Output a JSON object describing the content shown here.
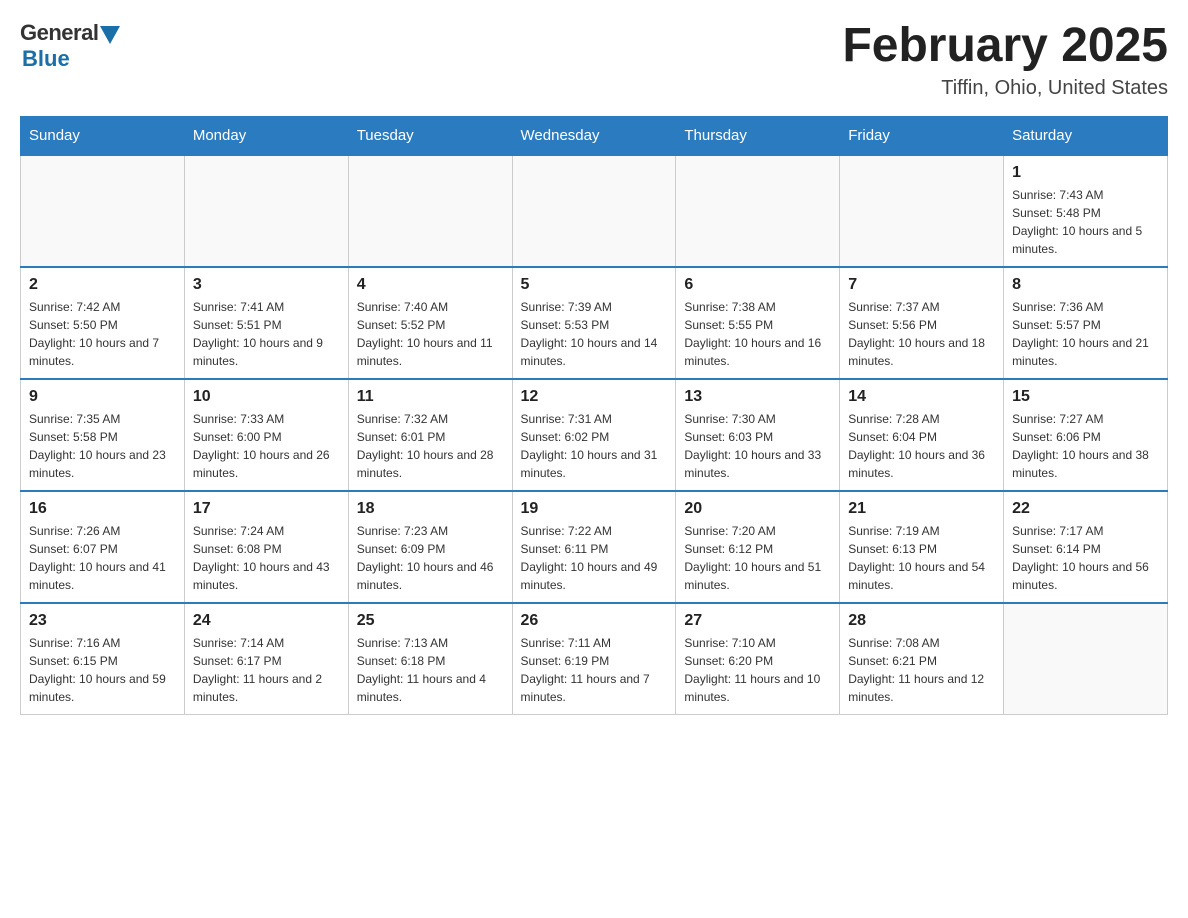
{
  "header": {
    "logo_general": "General",
    "logo_blue": "Blue",
    "month_title": "February 2025",
    "location": "Tiffin, Ohio, United States"
  },
  "days_of_week": [
    "Sunday",
    "Monday",
    "Tuesday",
    "Wednesday",
    "Thursday",
    "Friday",
    "Saturday"
  ],
  "weeks": [
    {
      "days": [
        {
          "num": "",
          "info": ""
        },
        {
          "num": "",
          "info": ""
        },
        {
          "num": "",
          "info": ""
        },
        {
          "num": "",
          "info": ""
        },
        {
          "num": "",
          "info": ""
        },
        {
          "num": "",
          "info": ""
        },
        {
          "num": "1",
          "info": "Sunrise: 7:43 AM\nSunset: 5:48 PM\nDaylight: 10 hours and 5 minutes."
        }
      ]
    },
    {
      "days": [
        {
          "num": "2",
          "info": "Sunrise: 7:42 AM\nSunset: 5:50 PM\nDaylight: 10 hours and 7 minutes."
        },
        {
          "num": "3",
          "info": "Sunrise: 7:41 AM\nSunset: 5:51 PM\nDaylight: 10 hours and 9 minutes."
        },
        {
          "num": "4",
          "info": "Sunrise: 7:40 AM\nSunset: 5:52 PM\nDaylight: 10 hours and 11 minutes."
        },
        {
          "num": "5",
          "info": "Sunrise: 7:39 AM\nSunset: 5:53 PM\nDaylight: 10 hours and 14 minutes."
        },
        {
          "num": "6",
          "info": "Sunrise: 7:38 AM\nSunset: 5:55 PM\nDaylight: 10 hours and 16 minutes."
        },
        {
          "num": "7",
          "info": "Sunrise: 7:37 AM\nSunset: 5:56 PM\nDaylight: 10 hours and 18 minutes."
        },
        {
          "num": "8",
          "info": "Sunrise: 7:36 AM\nSunset: 5:57 PM\nDaylight: 10 hours and 21 minutes."
        }
      ]
    },
    {
      "days": [
        {
          "num": "9",
          "info": "Sunrise: 7:35 AM\nSunset: 5:58 PM\nDaylight: 10 hours and 23 minutes."
        },
        {
          "num": "10",
          "info": "Sunrise: 7:33 AM\nSunset: 6:00 PM\nDaylight: 10 hours and 26 minutes."
        },
        {
          "num": "11",
          "info": "Sunrise: 7:32 AM\nSunset: 6:01 PM\nDaylight: 10 hours and 28 minutes."
        },
        {
          "num": "12",
          "info": "Sunrise: 7:31 AM\nSunset: 6:02 PM\nDaylight: 10 hours and 31 minutes."
        },
        {
          "num": "13",
          "info": "Sunrise: 7:30 AM\nSunset: 6:03 PM\nDaylight: 10 hours and 33 minutes."
        },
        {
          "num": "14",
          "info": "Sunrise: 7:28 AM\nSunset: 6:04 PM\nDaylight: 10 hours and 36 minutes."
        },
        {
          "num": "15",
          "info": "Sunrise: 7:27 AM\nSunset: 6:06 PM\nDaylight: 10 hours and 38 minutes."
        }
      ]
    },
    {
      "days": [
        {
          "num": "16",
          "info": "Sunrise: 7:26 AM\nSunset: 6:07 PM\nDaylight: 10 hours and 41 minutes."
        },
        {
          "num": "17",
          "info": "Sunrise: 7:24 AM\nSunset: 6:08 PM\nDaylight: 10 hours and 43 minutes."
        },
        {
          "num": "18",
          "info": "Sunrise: 7:23 AM\nSunset: 6:09 PM\nDaylight: 10 hours and 46 minutes."
        },
        {
          "num": "19",
          "info": "Sunrise: 7:22 AM\nSunset: 6:11 PM\nDaylight: 10 hours and 49 minutes."
        },
        {
          "num": "20",
          "info": "Sunrise: 7:20 AM\nSunset: 6:12 PM\nDaylight: 10 hours and 51 minutes."
        },
        {
          "num": "21",
          "info": "Sunrise: 7:19 AM\nSunset: 6:13 PM\nDaylight: 10 hours and 54 minutes."
        },
        {
          "num": "22",
          "info": "Sunrise: 7:17 AM\nSunset: 6:14 PM\nDaylight: 10 hours and 56 minutes."
        }
      ]
    },
    {
      "days": [
        {
          "num": "23",
          "info": "Sunrise: 7:16 AM\nSunset: 6:15 PM\nDaylight: 10 hours and 59 minutes."
        },
        {
          "num": "24",
          "info": "Sunrise: 7:14 AM\nSunset: 6:17 PM\nDaylight: 11 hours and 2 minutes."
        },
        {
          "num": "25",
          "info": "Sunrise: 7:13 AM\nSunset: 6:18 PM\nDaylight: 11 hours and 4 minutes."
        },
        {
          "num": "26",
          "info": "Sunrise: 7:11 AM\nSunset: 6:19 PM\nDaylight: 11 hours and 7 minutes."
        },
        {
          "num": "27",
          "info": "Sunrise: 7:10 AM\nSunset: 6:20 PM\nDaylight: 11 hours and 10 minutes."
        },
        {
          "num": "28",
          "info": "Sunrise: 7:08 AM\nSunset: 6:21 PM\nDaylight: 11 hours and 12 minutes."
        },
        {
          "num": "",
          "info": ""
        }
      ]
    }
  ]
}
